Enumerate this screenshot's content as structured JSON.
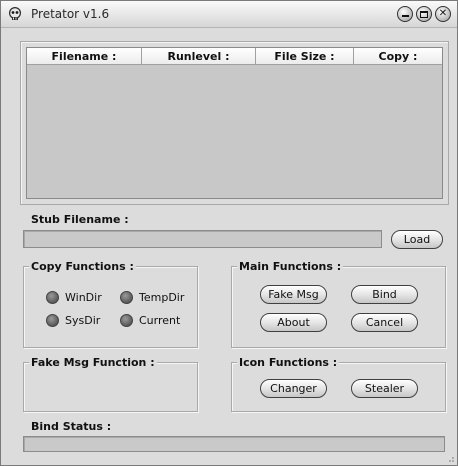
{
  "window": {
    "title": "Pretator v1.6",
    "icon": "skull-icon",
    "controls": [
      "minimize-icon",
      "maximize-icon",
      "close-icon"
    ]
  },
  "table": {
    "columns": [
      "Filename :",
      "Runlevel :",
      "File Size :",
      "Copy :"
    ],
    "rows": []
  },
  "stub": {
    "label": "Stub Filename :",
    "value": "",
    "load_label": "Load"
  },
  "copy_functions": {
    "title": "Copy Functions :",
    "options": [
      "WinDir",
      "TempDir",
      "SysDir",
      "Current"
    ]
  },
  "main_functions": {
    "title": "Main Functions :",
    "buttons": [
      "Fake Msg",
      "Bind",
      "About",
      "Cancel"
    ]
  },
  "fake_msg": {
    "title": "Fake Msg Function :"
  },
  "icon_functions": {
    "title": "Icon Functions :",
    "buttons": [
      "Changer",
      "Stealer"
    ]
  },
  "bind_status": {
    "label": "Bind Status :",
    "value": ""
  }
}
